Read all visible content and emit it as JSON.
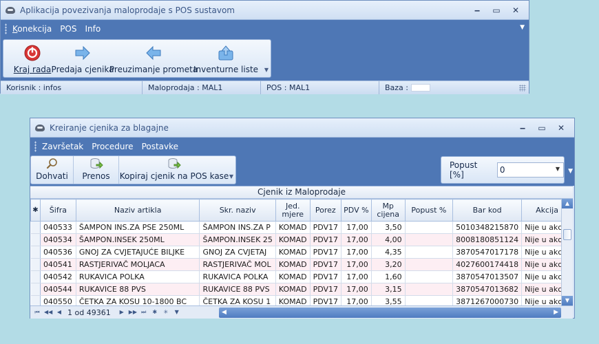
{
  "main": {
    "title": "Aplikacija povezivanja maloprodaje s POS sustavom",
    "menu": [
      "Konekcija",
      "POS",
      "Info"
    ],
    "toolbar": [
      {
        "label": "Kraj rada",
        "icon": "power-icon"
      },
      {
        "label": "Predaja cjenika",
        "icon": "arrow-right-icon"
      },
      {
        "label": "Preuzimanje prometa",
        "icon": "arrow-left-icon"
      },
      {
        "label": "Inventurne liste",
        "icon": "upload-icon"
      }
    ],
    "status": {
      "korisnik": "Korisnik : infos",
      "maloprodaja": "Maloprodaja : MAL1",
      "pos": "POS : MAL1",
      "baza": "Baza :"
    }
  },
  "child": {
    "title": "Kreiranje cjenika za blagajne",
    "menu": [
      "Završetak",
      "Procedure",
      "Postavke"
    ],
    "toolbar": [
      {
        "label": "Dohvati",
        "icon": "magnifier-icon"
      },
      {
        "label": "Prenos",
        "icon": "db-transfer-icon"
      },
      {
        "label": "Kopiraj cjenik na POS kase",
        "icon": "db-copy-icon"
      }
    ],
    "popust_label": "Popust [%]",
    "popust_value": "0",
    "grid_caption": "Cjenik iz Maloprodaje",
    "columns": [
      "Šifra",
      "Naziv artikla",
      "Skr. naziv",
      "Jed. mjere",
      "Porez",
      "PDV %",
      "Mp cijena",
      "Popust %",
      "Bar kod",
      "Akcija"
    ],
    "rows": [
      [
        "040533",
        "ŠAMPON INS.ZA PSE 250ML",
        "ŠAMPON INS.ZA P",
        "KOMAD",
        "PDV17",
        "17,00",
        "3,50",
        "",
        "5010348215870",
        "Nije u akciji"
      ],
      [
        "040534",
        "ŠAMPON.INSEK 250ML",
        "ŠAMPON.INSEK 25",
        "KOMAD",
        "PDV17",
        "17,00",
        "4,00",
        "",
        "8008180851124",
        "Nije u akciji"
      ],
      [
        "040536",
        "GNOJ ZA CVJETAJUĆE BILJKE",
        "GNOJ ZA CVJETAJ",
        "KOMAD",
        "PDV17",
        "17,00",
        "4,35",
        "",
        "3870547017178",
        "Nije u akciji"
      ],
      [
        "040541",
        "RASTJERIVAČ MOLJACA",
        "RASTJERIVAČ MOL",
        "KOMAD",
        "PDV17",
        "17,00",
        "3,20",
        "",
        "4027600174418",
        "Nije u akciji"
      ],
      [
        "040542",
        "RUKAVICA POLKA",
        "RUKAVICA POLKA",
        "KOMAD",
        "PDV17",
        "17,00",
        "1,60",
        "",
        "3870547013507",
        "Nije u akciji"
      ],
      [
        "040544",
        "RUKAVICE 88 PVS",
        "RUKAVICE 88 PVS",
        "KOMAD",
        "PDV17",
        "17,00",
        "3,15",
        "",
        "3870547013682",
        "Nije u akciji"
      ],
      [
        "040550",
        "ČETKA ZA KOSU 10-1800 BC",
        "ČETKA ZA KOSU 1",
        "KOMAD",
        "PDV17",
        "17,00",
        "3,55",
        "",
        "3871267000730",
        "Nije u akciji"
      ]
    ],
    "record_nav": "1 od 49361"
  }
}
